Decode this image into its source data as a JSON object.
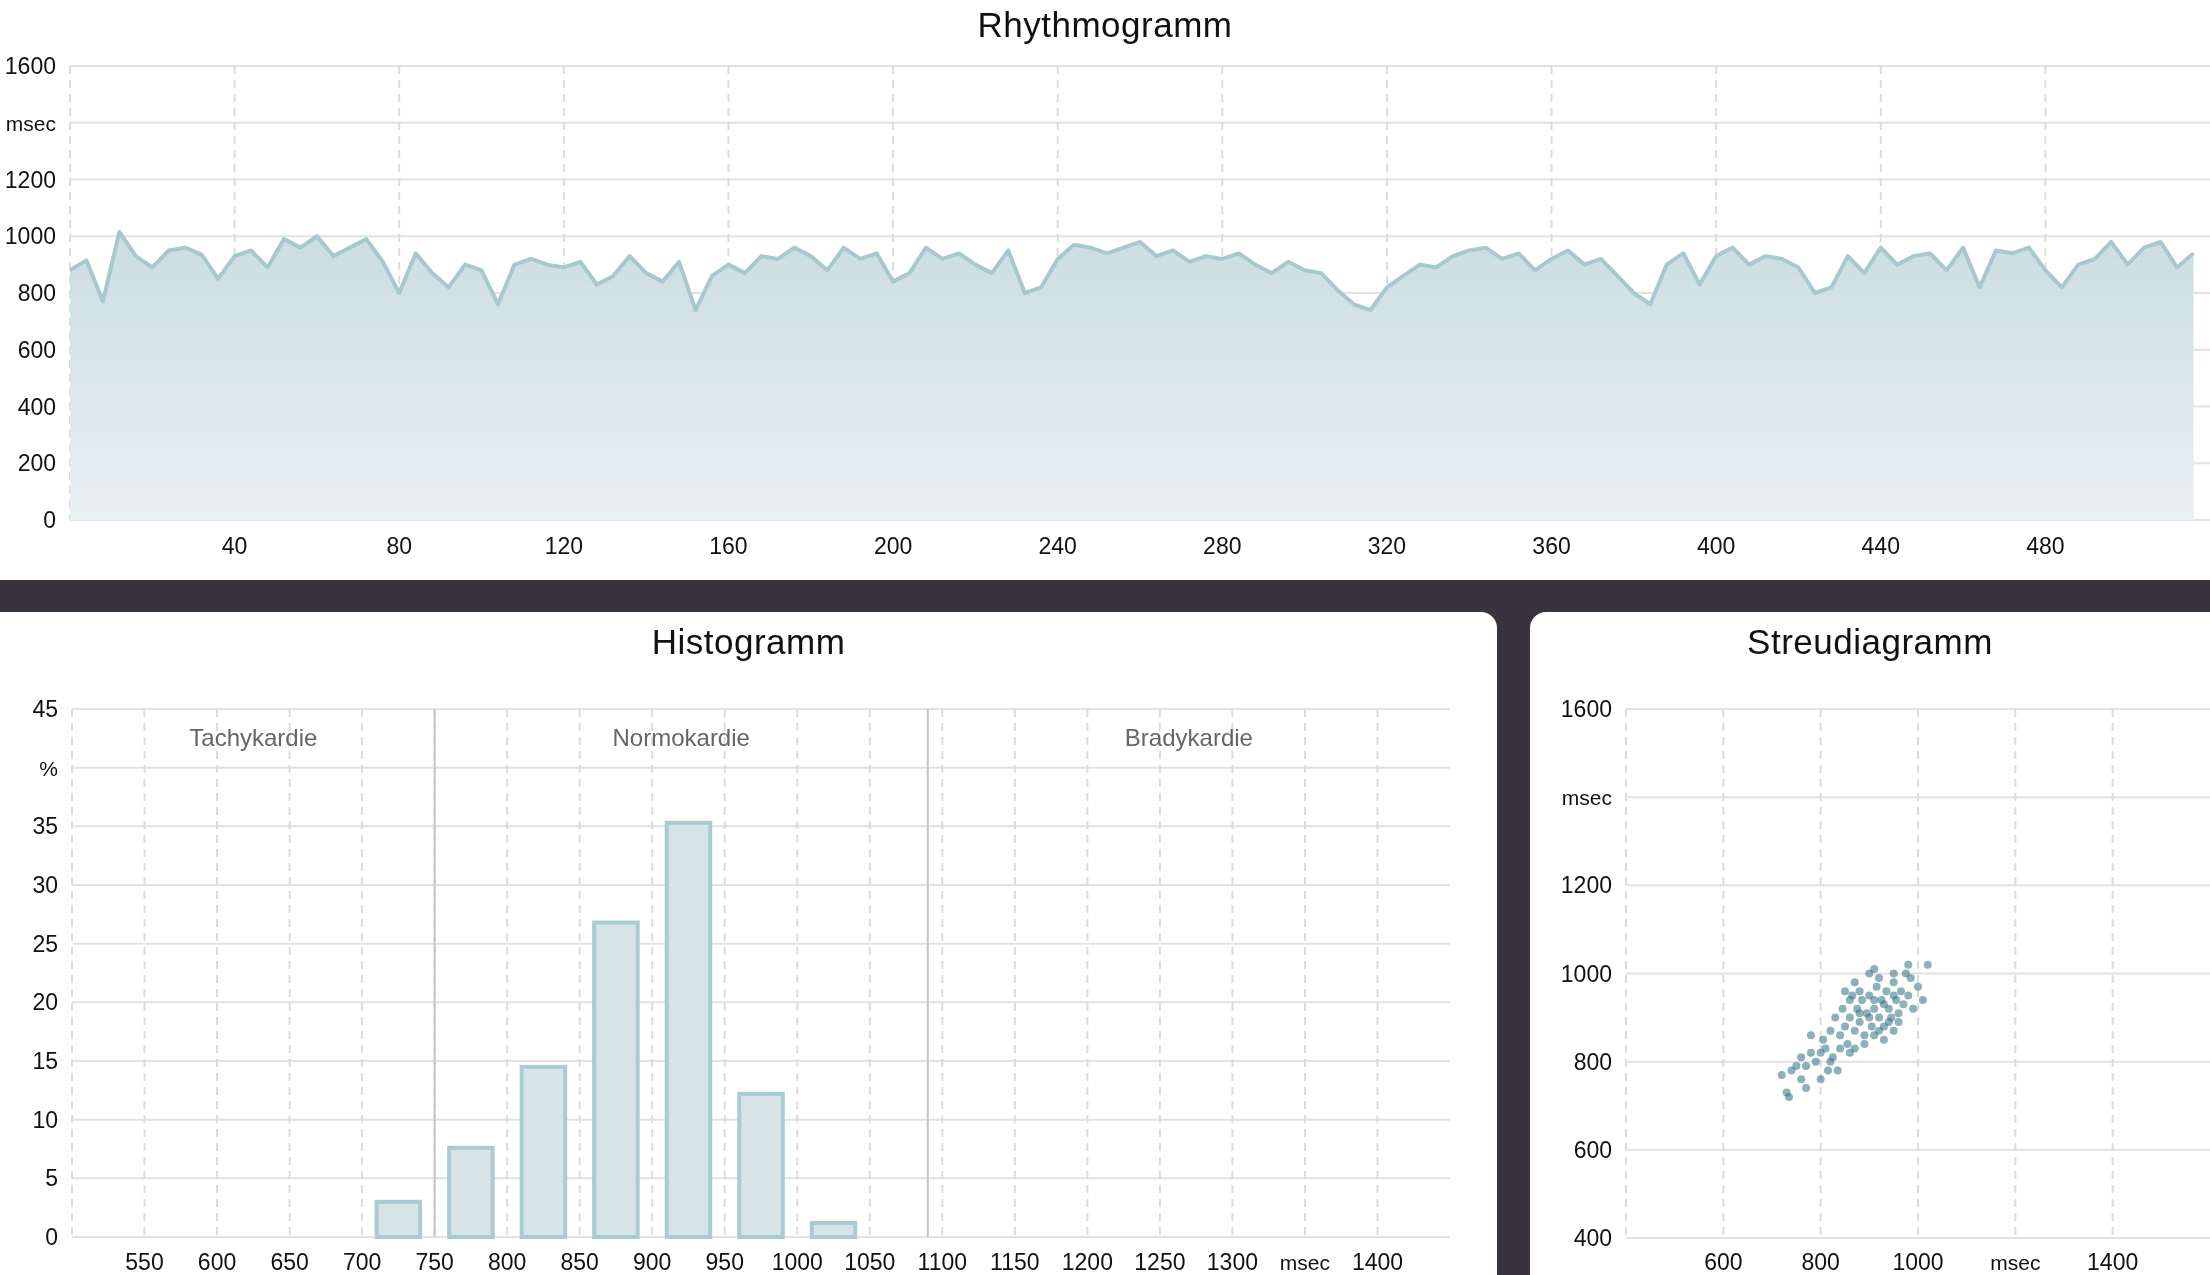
{
  "rhythmogram": {
    "title": "Rhythmogramm",
    "chart_data": {
      "type": "area",
      "grid": true,
      "xlim": [
        0,
        520
      ],
      "ylim": [
        0,
        1600
      ],
      "xticks": [
        40,
        80,
        120,
        160,
        200,
        240,
        280,
        320,
        360,
        400,
        440,
        480
      ],
      "yticks": [
        0,
        200,
        400,
        600,
        800,
        1000,
        1200,
        {
          "value": 1400,
          "label": "msec"
        },
        1600
      ],
      "x": [
        0,
        4,
        8,
        12,
        16,
        20,
        24,
        28,
        32,
        36,
        40,
        44,
        48,
        52,
        56,
        60,
        64,
        68,
        72,
        76,
        80,
        84,
        88,
        92,
        96,
        100,
        104,
        108,
        112,
        116,
        120,
        124,
        128,
        132,
        136,
        140,
        144,
        148,
        152,
        156,
        160,
        164,
        168,
        172,
        176,
        180,
        184,
        188,
        192,
        196,
        200,
        204,
        208,
        212,
        216,
        220,
        224,
        228,
        232,
        236,
        240,
        244,
        248,
        252,
        256,
        260,
        264,
        268,
        272,
        276,
        280,
        284,
        288,
        292,
        296,
        300,
        304,
        308,
        312,
        316,
        320,
        324,
        328,
        332,
        336,
        340,
        344,
        348,
        352,
        356,
        360,
        364,
        368,
        372,
        376,
        380,
        384,
        388,
        392,
        396,
        400,
        404,
        408,
        412,
        416,
        420,
        424,
        428,
        432,
        436,
        440,
        444,
        448,
        452,
        456,
        460,
        464,
        468,
        472,
        476,
        480,
        484,
        488,
        492,
        496,
        500,
        504,
        508,
        512,
        516
      ],
      "series": [
        {
          "color": "#a8c8d0",
          "values": [
            880,
            915,
            770,
            1015,
            930,
            890,
            950,
            960,
            935,
            850,
            930,
            950,
            890,
            990,
            960,
            1000,
            930,
            960,
            990,
            910,
            800,
            940,
            870,
            820,
            900,
            880,
            760,
            900,
            920,
            900,
            890,
            910,
            830,
            860,
            930,
            870,
            840,
            910,
            740,
            860,
            900,
            870,
            930,
            920,
            960,
            930,
            880,
            960,
            920,
            940,
            840,
            870,
            960,
            920,
            940,
            900,
            870,
            950,
            800,
            820,
            920,
            970,
            960,
            940,
            960,
            980,
            930,
            950,
            910,
            930,
            920,
            940,
            900,
            870,
            910,
            880,
            870,
            810,
            760,
            740,
            820,
            860,
            900,
            890,
            930,
            950,
            960,
            920,
            940,
            880,
            920,
            950,
            900,
            920,
            860,
            800,
            760,
            900,
            940,
            830,
            930,
            960,
            900,
            930,
            920,
            890,
            800,
            820,
            930,
            870,
            960,
            900,
            930,
            940,
            880,
            960,
            820,
            950,
            940,
            960,
            880,
            820,
            900,
            920,
            980,
            900,
            960,
            980,
            890,
            940
          ]
        }
      ]
    }
  },
  "histogram": {
    "title": "Histogramm",
    "chart_data": {
      "type": "bar",
      "grid": true,
      "xlim": [
        500,
        1450
      ],
      "ylim": [
        0,
        45
      ],
      "xticks": [
        550,
        600,
        650,
        700,
        750,
        800,
        850,
        900,
        950,
        1000,
        1050,
        1100,
        1150,
        1200,
        1250,
        1300,
        {
          "value": 1350,
          "label": "msec"
        },
        1400
      ],
      "yticks": [
        0,
        5,
        10,
        15,
        20,
        25,
        30,
        35,
        {
          "value": 40,
          "label": "%"
        },
        45
      ],
      "x": [
        725,
        775,
        825,
        875,
        925,
        975,
        1025
      ],
      "series": [
        {
          "color": "#d6e4e8",
          "values": [
            3,
            7.6,
            14.5,
            26.8,
            35.3,
            12.2,
            1.2
          ]
        }
      ],
      "ref_lines": [
        {
          "axis": "x",
          "value": 750
        },
        {
          "axis": "x",
          "value": 1090
        }
      ],
      "annotations": [
        "Tachykardie",
        "Normokardie",
        "Bradykardie"
      ]
    }
  },
  "scatter": {
    "title": "Streudiagramm",
    "chart_data": {
      "type": "scatter",
      "grid": true,
      "xlim": [
        400,
        1600
      ],
      "ylim": [
        400,
        1600
      ],
      "xticks": [
        600,
        800,
        1000,
        {
          "value": 1200,
          "label": "msec"
        },
        1400
      ],
      "yticks": [
        400,
        600,
        800,
        1000,
        1200,
        {
          "value": 1400,
          "label": "msec"
        },
        1600
      ],
      "x": [
        720,
        735,
        750,
        760,
        770,
        780,
        790,
        800,
        805,
        810,
        815,
        820,
        825,
        830,
        835,
        840,
        845,
        850,
        855,
        860,
        865,
        870,
        875,
        880,
        885,
        890,
        895,
        900,
        905,
        910,
        915,
        920,
        925,
        930,
        935,
        940,
        945,
        950,
        955,
        960,
        965,
        970,
        975,
        980,
        985,
        990,
        1000,
        1010,
        1020,
        880,
        900,
        920,
        860,
        870,
        890,
        910,
        930,
        950,
        940,
        920,
        900,
        910,
        930,
        950,
        960,
        880,
        860,
        840,
        820,
        800,
        780,
        770,
        760,
        740,
        730,
        850,
        870,
        910,
        950,
        980
      ],
      "series": [
        {
          "color": "#2f6f84",
          "values": [
            770,
            720,
            790,
            760,
            740,
            820,
            800,
            760,
            850,
            830,
            780,
            870,
            810,
            900,
            780,
            860,
            920,
            880,
            840,
            900,
            950,
            870,
            920,
            890,
            940,
            860,
            910,
            950,
            880,
            920,
            970,
            900,
            940,
            880,
            960,
            920,
            900,
            980,
            940,
            910,
            960,
            930,
            1000,
            950,
            990,
            920,
            970,
            940,
            1020,
            960,
            1000,
            990,
            820,
            830,
            840,
            860,
            850,
            870,
            890,
            870,
            900,
            940,
            930,
            950,
            890,
            910,
            940,
            830,
            800,
            820,
            860,
            790,
            810,
            780,
            730,
            960,
            980,
            1010,
            1000,
            1020
          ]
        }
      ]
    }
  }
}
